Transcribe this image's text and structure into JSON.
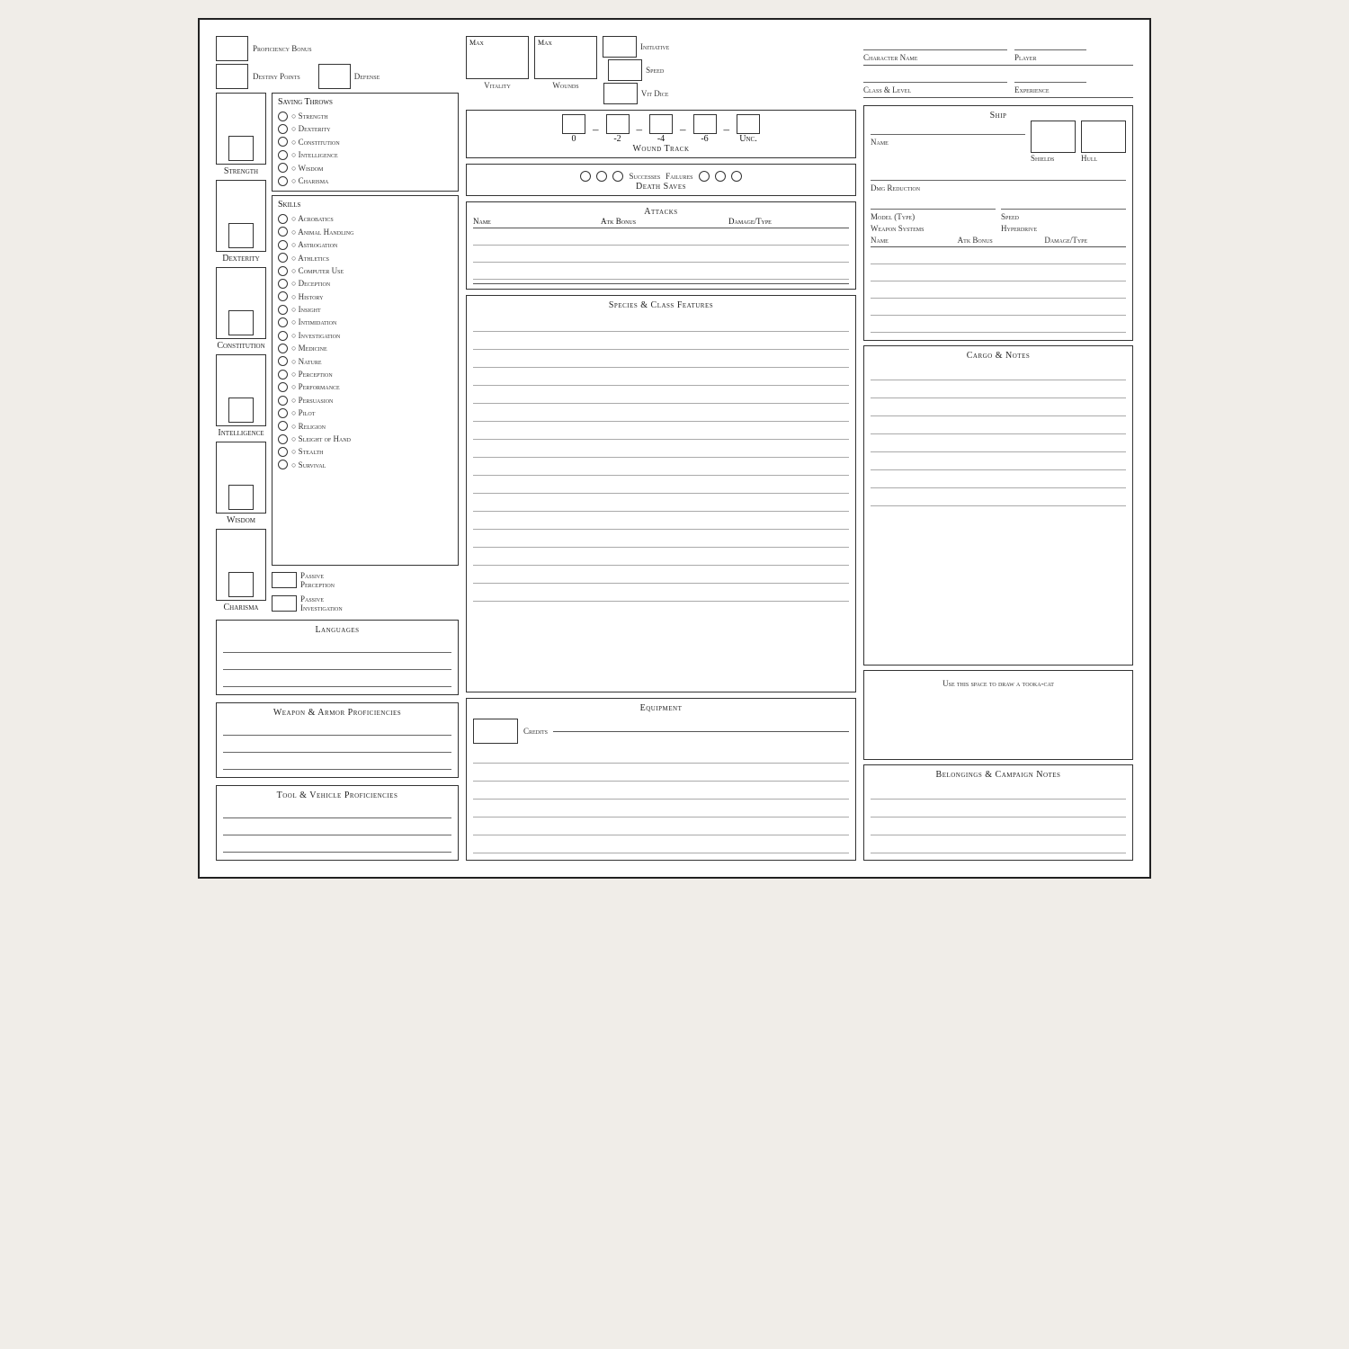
{
  "sheet": {
    "proficiency_bonus_label": "Proficiency Bonus",
    "destiny_points_label": "Destiny Points",
    "defense_label": "Defense",
    "saving_throws_label": "Saving Throws",
    "strength_label": "Strength",
    "dexterity_label": "Dexterity",
    "constitution_label": "Constitution",
    "intelligence_label": "Intelligence",
    "wisdom_label": "Wisdom",
    "charisma_label": "Charisma",
    "stats": [
      {
        "name": "Strength",
        "id": "str"
      },
      {
        "name": "Dexterity",
        "id": "dex"
      },
      {
        "name": "Constitution",
        "id": "con"
      },
      {
        "name": "Intelligence",
        "id": "int"
      },
      {
        "name": "Wisdom",
        "id": "wis"
      },
      {
        "name": "Charisma",
        "id": "cha"
      }
    ],
    "saving_throws": [
      "Strength",
      "Dexterity",
      "Constitution",
      "Intelligence",
      "Wisdom",
      "Charisma"
    ],
    "skills_label": "Skills",
    "skills": [
      "Acrobatics",
      "Animal Handling",
      "Astrogation",
      "Athletics",
      "Computer Use",
      "Deception",
      "History",
      "Insight",
      "Intimidation",
      "Investigation",
      "Medicine",
      "Nature",
      "Perception",
      "Performance",
      "Persuasion",
      "Pilot",
      "Religion",
      "Sleight of Hand",
      "Stealth",
      "Survival"
    ],
    "passive_perception_label": "Passive",
    "passive_perception_sub": "Perception",
    "passive_investigation_label": "Passive",
    "passive_investigation_sub": "Investigation",
    "languages_label": "Languages",
    "weapon_armor_label": "Weapon & Armor Proficiencies",
    "tool_vehicle_label": "Tool & Vehicle Proficiencies",
    "vitality_label": "Vitality",
    "wounds_label": "Wounds",
    "initiative_label": "Initiative",
    "speed_label": "Speed",
    "vit_dice_label": "Vit Dice",
    "max_label": "Max",
    "wound_track_label": "Wound Track",
    "wound_values": [
      "0",
      "-2",
      "-4",
      "-6",
      "Unc."
    ],
    "death_saves_label": "Death Saves",
    "successes_label": "Successes",
    "failures_label": "Failures",
    "attacks_label": "Attacks",
    "atk_name_label": "Name",
    "atk_bonus_label": "Atk Bonus",
    "atk_damage_label": "Damage/Type",
    "features_label": "Species & Class Features",
    "equipment_label": "Equipment",
    "credits_label": "Credits",
    "char_name_label": "Character Name",
    "player_label": "Player",
    "class_level_label": "Class & Level",
    "experience_label": "Experience",
    "ship_label": "Ship",
    "ship_name_label": "Name",
    "ship_shields_label": "Shields",
    "ship_hull_label": "Hull",
    "dmg_reduction_label": "Dmg Reduction",
    "model_type_label": "Model (Type)",
    "speed_ship_label": "Speed",
    "weapon_systems_label": "Weapon Systems",
    "hyperdrive_label": "Hyperdrive",
    "ws_name_label": "Name",
    "ws_atk_label": "Atk Bonus",
    "ws_dmg_label": "Damage/Type",
    "cargo_notes_label": "Cargo & Notes",
    "tooka_label": "Use this space to draw a tooka-cat",
    "belongings_label": "Belongings & Campaign Notes"
  }
}
